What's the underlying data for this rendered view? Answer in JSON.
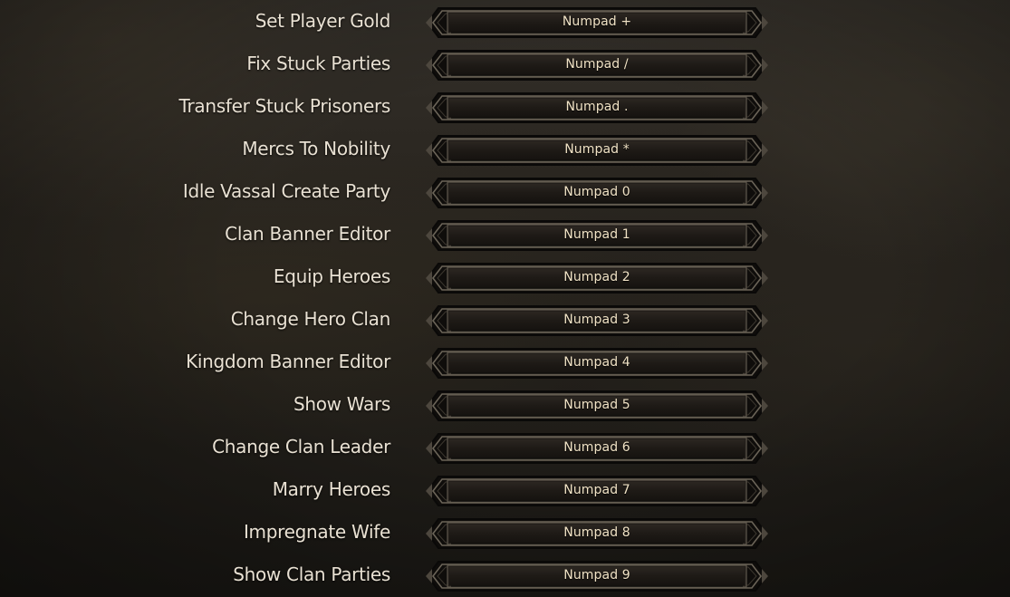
{
  "keybindings": [
    {
      "label": "Set Player Gold",
      "key": "Numpad +"
    },
    {
      "label": "Fix Stuck Parties",
      "key": "Numpad /"
    },
    {
      "label": "Transfer Stuck Prisoners",
      "key": "Numpad ."
    },
    {
      "label": "Mercs To Nobility",
      "key": "Numpad *"
    },
    {
      "label": "Idle Vassal Create Party",
      "key": "Numpad 0"
    },
    {
      "label": "Clan Banner Editor",
      "key": "Numpad 1"
    },
    {
      "label": "Equip Heroes",
      "key": "Numpad 2"
    },
    {
      "label": "Change Hero Clan",
      "key": "Numpad 3"
    },
    {
      "label": "Kingdom Banner Editor",
      "key": "Numpad 4"
    },
    {
      "label": "Show Wars",
      "key": "Numpad 5"
    },
    {
      "label": "Change Clan Leader",
      "key": "Numpad 6"
    },
    {
      "label": "Marry Heroes",
      "key": "Numpad 7"
    },
    {
      "label": "Impregnate Wife",
      "key": "Numpad 8"
    },
    {
      "label": "Show Clan Parties",
      "key": "Numpad 9"
    }
  ],
  "colors": {
    "label_text": "#e9e1d3",
    "key_text": "#f1e3c6",
    "frame_outer": "#0f0d0b",
    "frame_inner": "#221e1a",
    "frame_border": "#6b6458"
  }
}
